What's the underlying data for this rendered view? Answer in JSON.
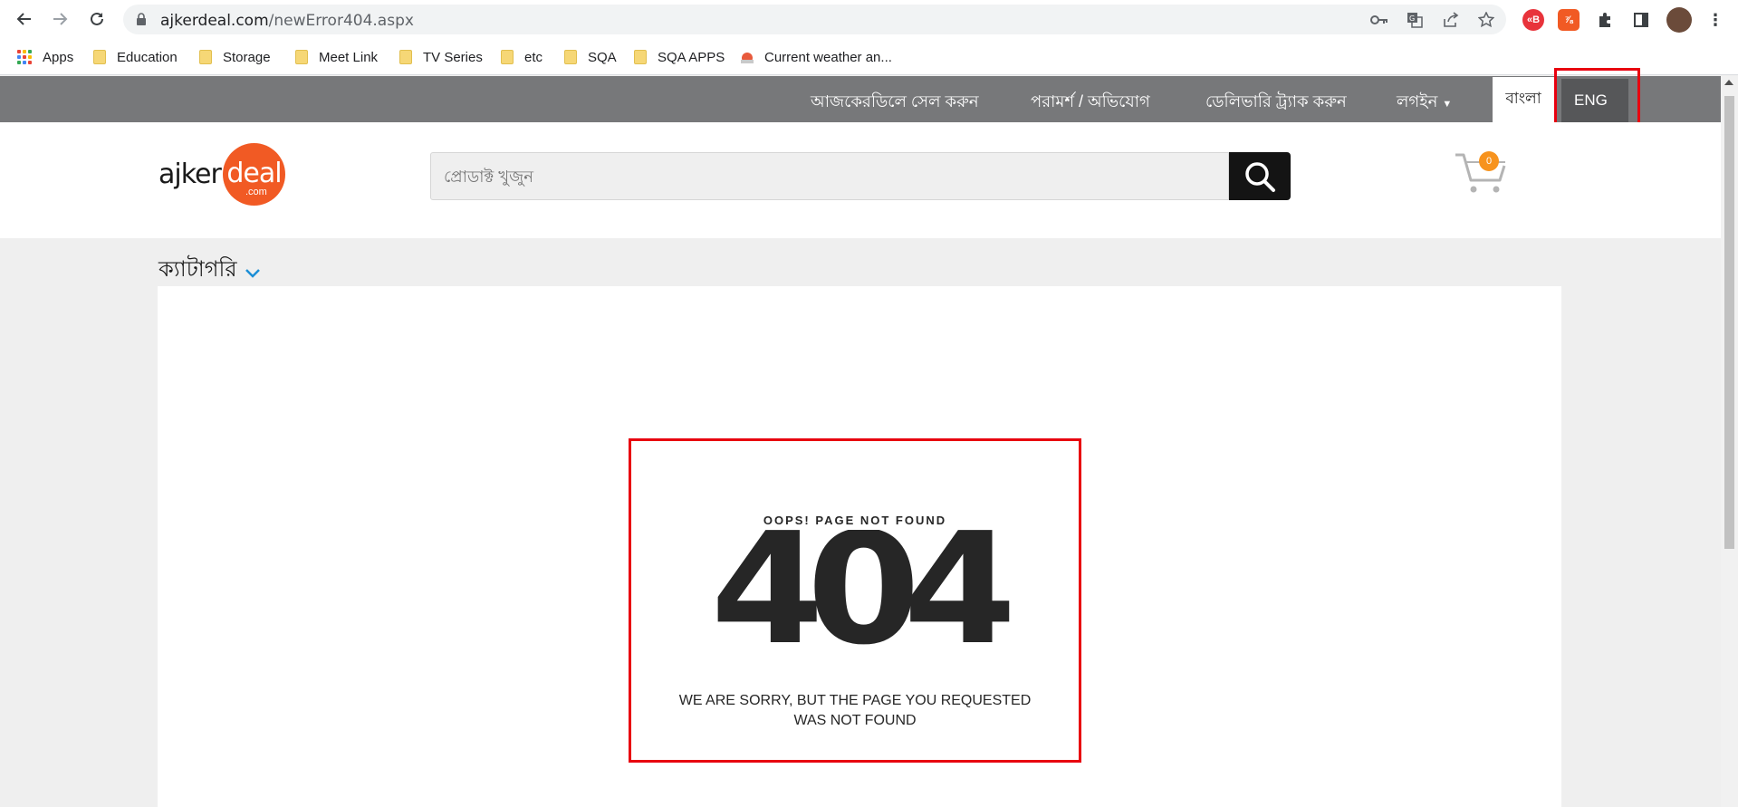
{
  "browser": {
    "url_domain": "ajkerdeal.com",
    "url_path": "/newError404.aspx",
    "icons": [
      "back-icon",
      "forward-icon",
      "reload-icon",
      "lock-icon",
      "key-icon",
      "translate-icon",
      "share-icon",
      "star-icon",
      "extension-icon",
      "puzzle-icon",
      "sidebar-icon",
      "profile-avatar",
      "menu-icon"
    ],
    "bookmarks": [
      {
        "label": "Apps",
        "icon": "apps-grid-icon"
      },
      {
        "label": "Education",
        "icon": "folder-icon"
      },
      {
        "label": "Storage",
        "icon": "folder-icon"
      },
      {
        "label": "Meet Link",
        "icon": "folder-icon"
      },
      {
        "label": "TV Series",
        "icon": "folder-icon"
      },
      {
        "label": "etc",
        "icon": "folder-icon"
      },
      {
        "label": "SQA",
        "icon": "folder-icon"
      },
      {
        "label": "SQA APPS",
        "icon": "folder-icon"
      },
      {
        "label": "Current weather an...",
        "icon": "weather-icon"
      }
    ]
  },
  "topbar": {
    "sell": "আজকেরডিলে সেল করুন",
    "feedback": "পরামর্শ / অভিযোগ",
    "track": "ডেলিভারি ট্র্যাক করুন",
    "login": "লগইন",
    "lang_bn": "বাংলা",
    "lang_en": "ENG"
  },
  "header": {
    "logo_word": "ajker",
    "logo_deal": "deal",
    "logo_com": ".com",
    "search_placeholder": "প্রোডাক্ট খুজুন",
    "cart_count": "0"
  },
  "category": {
    "label": "ক্যাটাগরি"
  },
  "error": {
    "oops": "OOPS! PAGE NOT FOUND",
    "code": "404",
    "message": "WE ARE SORRY, BUT THE PAGE YOU REQUESTED WAS NOT FOUND"
  },
  "colors": {
    "topbar": "#77787a",
    "accent": "#f15a24",
    "highlight": "#e8000f",
    "cart_badge": "#f7931e"
  }
}
